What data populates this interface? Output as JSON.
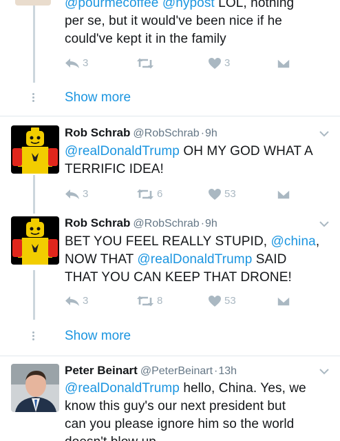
{
  "tweet0": {
    "lines": [
      [
        {
          "t": "@pourmecoffee",
          "m": true
        },
        {
          "t": " ",
          "m": false
        },
        {
          "t": "@nypost",
          "m": true
        },
        {
          "t": " LOL, nothing",
          "m": false
        }
      ],
      [
        {
          "t": "per se, but it would've been nice if he",
          "m": false
        }
      ],
      [
        {
          "t": "could've kept it in the family",
          "m": false
        }
      ]
    ],
    "reply_count": "3",
    "retweet_count": "",
    "like_count": "3"
  },
  "show_more_label": "Show more",
  "tweet1": {
    "name": "Rob Schrab",
    "handle": "@RobSchrab",
    "sep": "·",
    "time": "9h",
    "lines": [
      [
        {
          "t": "@realDonaldTrump",
          "m": true
        },
        {
          "t": " OH MY GOD WHAT A",
          "m": false
        }
      ],
      [
        {
          "t": "TERRIFIC IDEA!",
          "m": false
        }
      ]
    ],
    "reply_count": "3",
    "retweet_count": "6",
    "like_count": "53"
  },
  "tweet2": {
    "name": "Rob Schrab",
    "handle": "@RobSchrab",
    "sep": "·",
    "time": "9h",
    "lines": [
      [
        {
          "t": "BET YOU FEEL REALLY STUPID, ",
          "m": false
        },
        {
          "t": "@china",
          "m": true
        },
        {
          "t": ",",
          "m": false
        }
      ],
      [
        {
          "t": "NOW THAT ",
          "m": false
        },
        {
          "t": "@realDonaldTrump",
          "m": true
        },
        {
          "t": " SAID",
          "m": false
        }
      ],
      [
        {
          "t": "THAT YOU CAN KEEP THAT DRONE!",
          "m": false
        }
      ]
    ],
    "reply_count": "3",
    "retweet_count": "8",
    "like_count": "53"
  },
  "tweet3": {
    "name": "Peter Beinart",
    "handle": "@PeterBeinart",
    "sep": "·",
    "time": "13h",
    "lines": [
      [
        {
          "t": "@realDonaldTrump",
          "m": true
        },
        {
          "t": " hello, China. Yes, we",
          "m": false
        }
      ],
      [
        {
          "t": "know this guy's our next president but",
          "m": false
        }
      ],
      [
        {
          "t": "can you please ignore him so the world",
          "m": false
        }
      ],
      [
        {
          "t": "doesn't blow up",
          "m": false
        }
      ]
    ]
  },
  "colors": {
    "mention": "#1b95e0",
    "icon_gray": "#aab8c2",
    "handle_gray": "#657786",
    "thread_line": "#ccd6dd",
    "divider": "#e1e8ed"
  },
  "icons": [
    "reply-icon",
    "retweet-icon",
    "like-icon",
    "direct-message-icon",
    "chevron-down-icon",
    "more-dots-icon"
  ]
}
